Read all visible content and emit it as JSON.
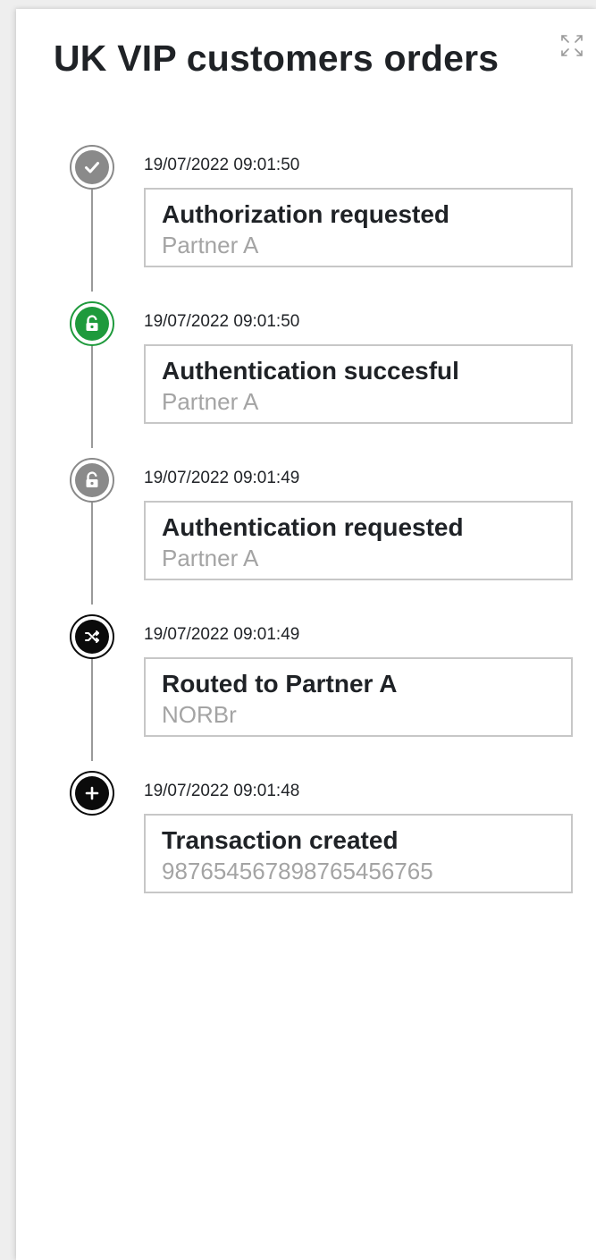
{
  "panel": {
    "title": "UK VIP customers orders",
    "expand_icon": "expand-arrows-icon"
  },
  "colors": {
    "done": "#8a8a8a",
    "success": "#1e9a3c",
    "pending": "#8a8a8a",
    "system": "#0b0b0b",
    "created": "#0b0b0b",
    "connector": "#9a9a9a",
    "card_border": "#c7c7c7",
    "subtitle": "#a4a4a4"
  },
  "events": [
    {
      "timestamp": "19/07/2022 09:01:50",
      "title": "Authorization requested",
      "subtitle": "Partner A",
      "icon": "check-icon",
      "status": "done"
    },
    {
      "timestamp": "19/07/2022 09:01:50",
      "title": "Authentication succesful",
      "subtitle": "Partner A",
      "icon": "unlock-icon",
      "status": "success"
    },
    {
      "timestamp": "19/07/2022 09:01:49",
      "title": "Authentication requested",
      "subtitle": "Partner A",
      "icon": "unlock-icon",
      "status": "pending"
    },
    {
      "timestamp": "19/07/2022 09:01:49",
      "title": "Routed to Partner A",
      "subtitle": "NORBr",
      "icon": "shuffle-icon",
      "status": "system"
    },
    {
      "timestamp": "19/07/2022 09:01:48",
      "title": "Transaction created",
      "subtitle": "987654567898765456765",
      "icon": "plus-icon",
      "status": "created"
    }
  ]
}
